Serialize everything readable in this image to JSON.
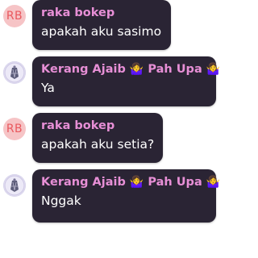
{
  "messages": [
    {
      "avatar_type": "initials",
      "avatar_initials": "RB",
      "sender": "raka bokep",
      "sender_emoji_1": "",
      "sender_part2": "",
      "sender_emoji_2": "",
      "text": "apakah aku sasimo"
    },
    {
      "avatar_type": "image",
      "avatar_icon": "shell-icon",
      "sender": "Kerang Ajaib",
      "sender_emoji_1": "🤷‍♀️",
      "sender_part2": "Pah Upa",
      "sender_emoji_2": "🤷‍♀️",
      "text": "Ya"
    },
    {
      "avatar_type": "initials",
      "avatar_initials": "RB",
      "sender": "raka bokep",
      "sender_emoji_1": "",
      "sender_part2": "",
      "sender_emoji_2": "",
      "text": "apakah aku setia?"
    },
    {
      "avatar_type": "image",
      "avatar_icon": "shell-icon",
      "sender": "Kerang Ajaib",
      "sender_emoji_1": "🤷‍♀️",
      "sender_part2": "Pah Upa",
      "sender_emoji_2": "🤷‍♀️",
      "text": "Nggak"
    }
  ],
  "colors": {
    "bubble_bg": "#2a2434",
    "sender_name": "#e78fd6",
    "message_text": "#ffffff",
    "avatar_initials_bg": "#f6c4c6",
    "avatar_initials_text": "#e9585e"
  }
}
